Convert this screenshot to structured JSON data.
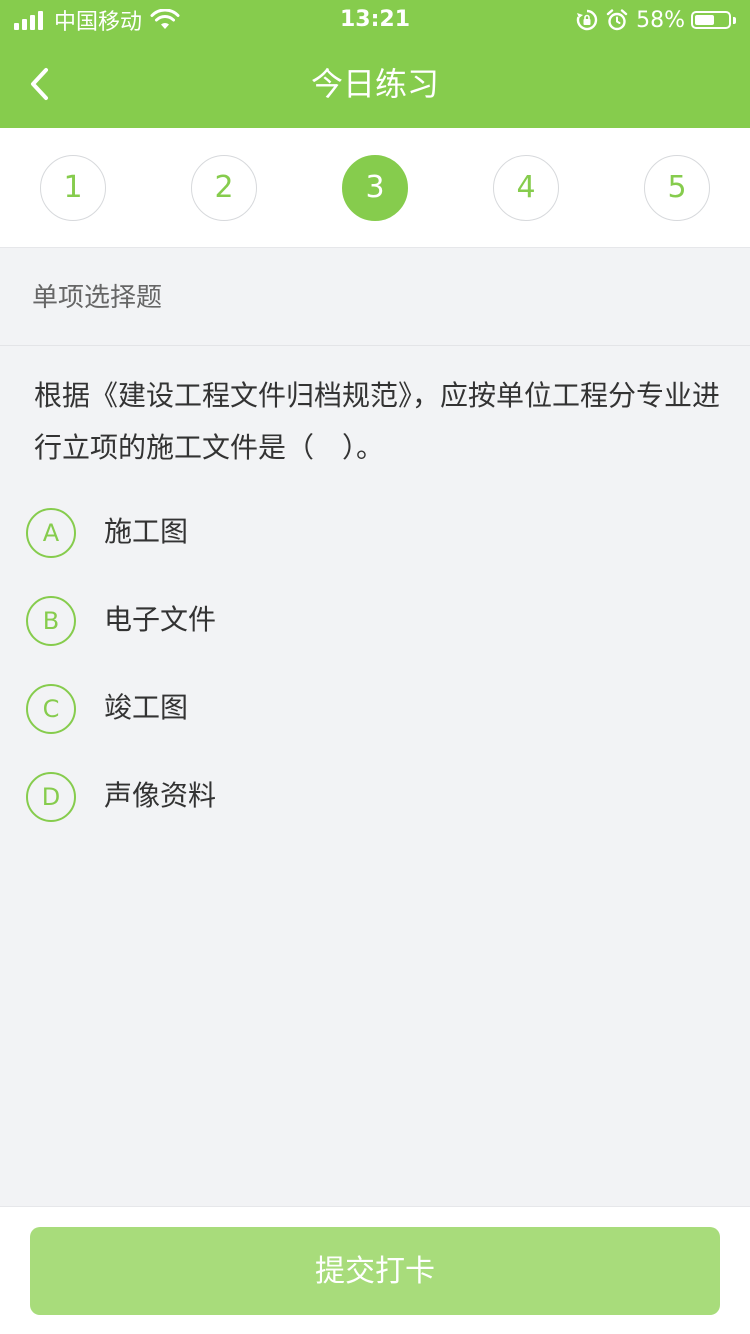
{
  "status_bar": {
    "carrier": "中国移动",
    "time": "13:21",
    "battery_percent": "58%",
    "battery_level": 0.58
  },
  "nav": {
    "title": "今日练习",
    "back_icon": "chevron-left-icon"
  },
  "steps": [
    {
      "label": "1",
      "active": false
    },
    {
      "label": "2",
      "active": false
    },
    {
      "label": "3",
      "active": true
    },
    {
      "label": "4",
      "active": false
    },
    {
      "label": "5",
      "active": false
    }
  ],
  "question": {
    "type_label": "单项选择题",
    "text": "根据《建设工程文件归档规范》，应按单位工程分专业进行立项的施工文件是（　）。",
    "options": [
      {
        "letter": "A",
        "text": "施工图"
      },
      {
        "letter": "B",
        "text": "电子文件"
      },
      {
        "letter": "C",
        "text": "竣工图"
      },
      {
        "letter": "D",
        "text": "声像资料"
      }
    ]
  },
  "submit_label": "提交打卡",
  "colors": {
    "brand_green": "#86cc4d",
    "submit_green": "#a8dc7b",
    "background": "#f2f3f5"
  }
}
